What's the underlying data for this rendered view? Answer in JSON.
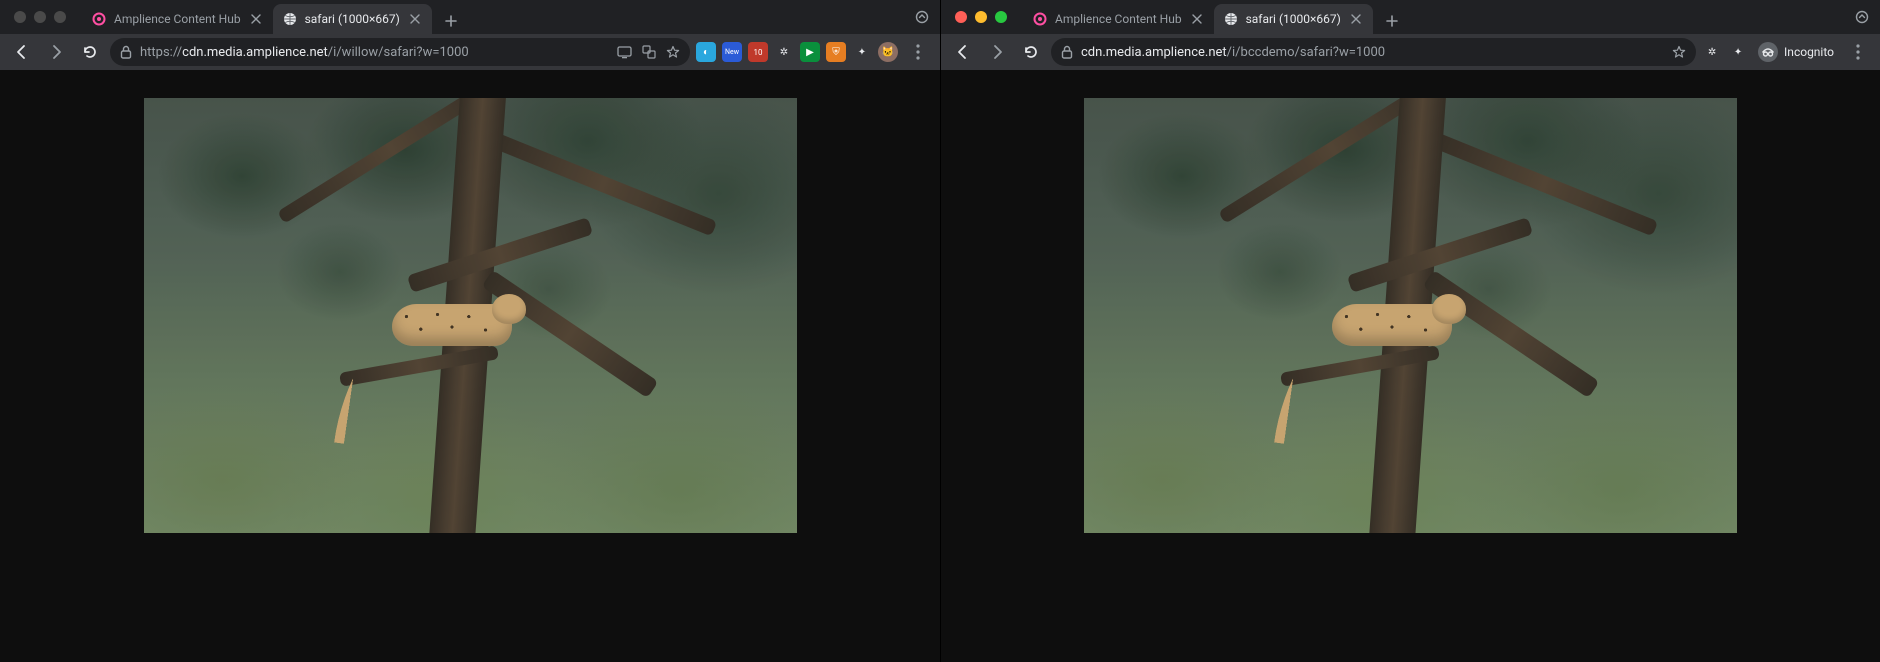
{
  "left": {
    "traffic_lights_dimmed": true,
    "tabs": [
      {
        "title": "Amplience Content Hub",
        "active": false,
        "favicon": "amplience"
      },
      {
        "title": "safari (1000×667)",
        "active": true,
        "favicon": "globe"
      }
    ],
    "url_host": "cdn.media.amplience.net",
    "url_prefix": "https://",
    "url_path": "/i/willow/safari?w=1000",
    "omnibox_icons": [
      "cast-icon",
      "translate-icon",
      "star-icon"
    ],
    "extensions": [
      {
        "name": "ext-1",
        "bg": "#2aa7de",
        "glyph": "◐"
      },
      {
        "name": "ext-new",
        "bg": "#2b5bd7",
        "glyph": "New"
      },
      {
        "name": "ext-cal",
        "bg": "#c0392b",
        "glyph": "10"
      },
      {
        "name": "ext-gear",
        "bg": "transparent",
        "glyph": "⚙"
      },
      {
        "name": "ext-rec",
        "bg": "#0a8f3c",
        "glyph": "▶"
      },
      {
        "name": "ext-shield",
        "bg": "#e67e22",
        "glyph": "⛨"
      },
      {
        "name": "ext-puzzle",
        "bg": "transparent",
        "glyph": "✦"
      },
      {
        "name": "ext-avatar",
        "bg": "#8d6e63",
        "glyph": "🐱"
      }
    ]
  },
  "right": {
    "traffic_lights_dimmed": false,
    "tabs": [
      {
        "title": "Amplience Content Hub",
        "active": false,
        "favicon": "amplience"
      },
      {
        "title": "safari (1000×667)",
        "active": true,
        "favicon": "globe"
      }
    ],
    "url_host": "cdn.media.amplience.net",
    "url_prefix": "",
    "url_path": "/i/bccdemo/safari?w=1000",
    "omnibox_icons": [
      "star-icon"
    ],
    "toolbar_right": {
      "incognito_label": "Incognito"
    }
  },
  "image_alt": "Leopard resting on a tree branch among green foliage"
}
